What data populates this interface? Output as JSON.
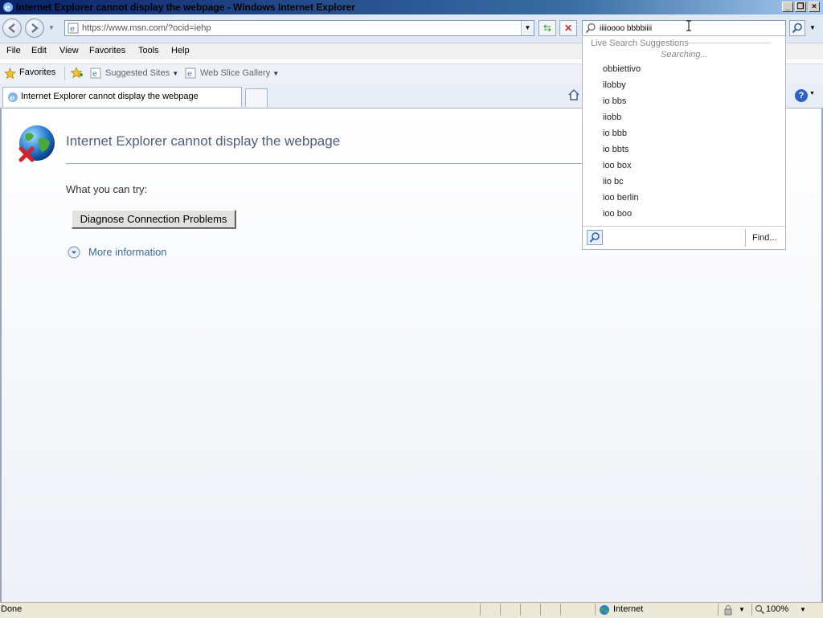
{
  "window": {
    "title": "Internet Explorer cannot display the webpage - Windows Internet Explorer"
  },
  "address_bar": {
    "url": "https://www.msn.com/?ocid=iehp"
  },
  "search": {
    "value": "iiiioooo    bbbbiiii",
    "suggestions_header": "Live Search Suggestions",
    "searching_text": "Searching...",
    "suggestions": [
      "obbiettivo",
      "ilobby",
      "io bbs",
      "iiobb",
      "io bbb",
      "io bbts",
      "ioo box",
      "iio bc",
      "ioo berlin",
      "ioo boo"
    ],
    "find_label": "Find..."
  },
  "menu": {
    "items": [
      "File",
      "Edit",
      "View",
      "Favorites",
      "Tools",
      "Help"
    ]
  },
  "favorites_bar": {
    "favorites_label": "Favorites",
    "links": [
      "Suggested Sites",
      "Web Slice Gallery"
    ]
  },
  "tabs": [
    {
      "label": "Internet Explorer cannot display the webpage"
    }
  ],
  "page": {
    "heading": "Internet Explorer cannot display the webpage",
    "what_you_can_try": "What you can try:",
    "diagnose_button": "Diagnose Connection Problems",
    "more_information": "More information"
  },
  "status_bar": {
    "status": "Done",
    "zone": "Internet",
    "zoom": "100%"
  },
  "colors": {
    "title_bar": "#0a246a",
    "heading_text": "#4e5e7e",
    "link_text": "#3c6a9c",
    "error_x": "#d2242b"
  }
}
